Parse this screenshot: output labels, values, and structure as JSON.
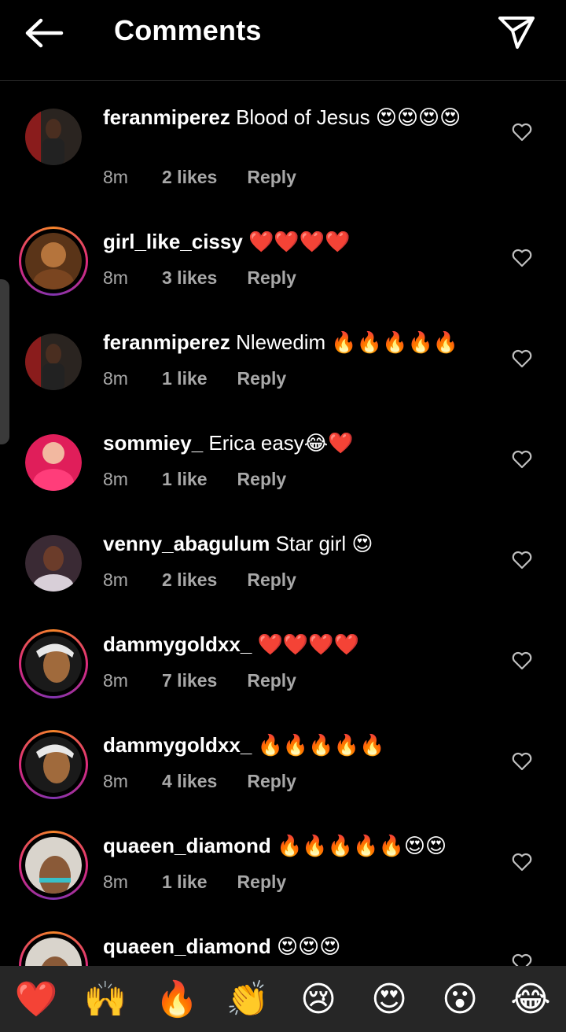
{
  "header": {
    "title": "Comments"
  },
  "comments": [
    {
      "username": "feranmiperez",
      "text": " Blood of Jesus 😍😍😍😍",
      "time": "8m",
      "likes": "2 likes",
      "reply": "Reply"
    },
    {
      "username": "girl_like_cissy",
      "text": " ❤️❤️❤️❤️",
      "time": "8m",
      "likes": "3 likes",
      "reply": "Reply"
    },
    {
      "username": "feranmiperez",
      "text": " Nlewedim 🔥🔥🔥🔥🔥",
      "time": "8m",
      "likes": "1 like",
      "reply": "Reply"
    },
    {
      "username": "sommiey_",
      "text": " Erica easy😂❤️",
      "time": "8m",
      "likes": "1 like",
      "reply": "Reply"
    },
    {
      "username": "venny_abagulum",
      "text": " Star girl 😍",
      "time": "8m",
      "likes": "2 likes",
      "reply": "Reply"
    },
    {
      "username": "dammygoldxx_",
      "text": " ❤️❤️❤️❤️",
      "time": "8m",
      "likes": "7 likes",
      "reply": "Reply"
    },
    {
      "username": "dammygoldxx_",
      "text": " 🔥🔥🔥🔥🔥",
      "time": "8m",
      "likes": "4 likes",
      "reply": "Reply"
    },
    {
      "username": "quaeen_diamond",
      "text": " 🔥🔥🔥🔥🔥😍😍",
      "time": "8m",
      "likes": "1 like",
      "reply": "Reply"
    },
    {
      "username": "quaeen_diamond",
      "text": " 😍😍😍",
      "time": "",
      "likes": "",
      "reply": ""
    }
  ],
  "reactions": [
    "❤️",
    "🙌",
    "🔥",
    "👏",
    "😢",
    "😍",
    "😮",
    "😂"
  ],
  "colors": {
    "background": "#000000",
    "meta_text": "#a8a8a8",
    "reaction_bar": "#262626"
  }
}
